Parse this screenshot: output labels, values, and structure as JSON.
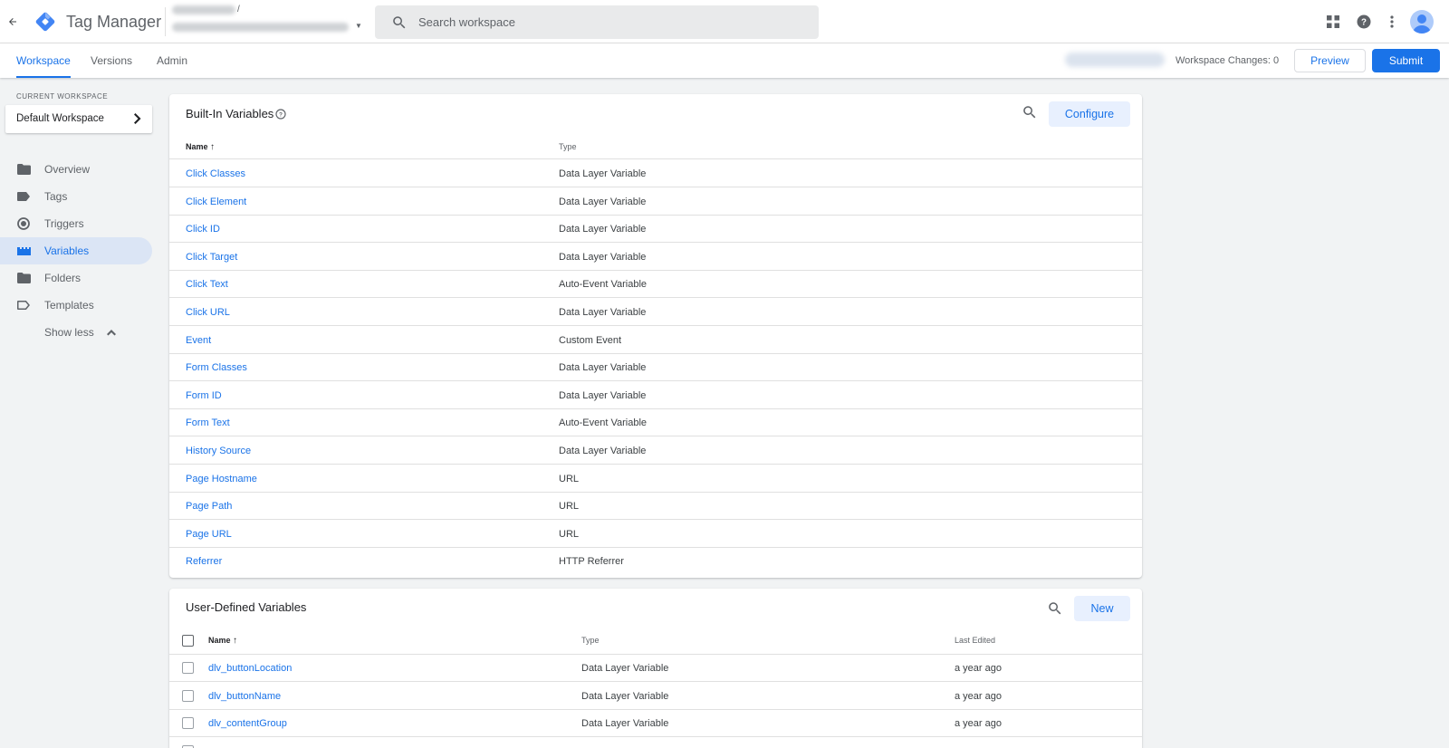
{
  "app": {
    "title": "Tag Manager",
    "account_separator": "/"
  },
  "search": {
    "placeholder": "Search workspace"
  },
  "top_icons": [
    "apps-grid-icon",
    "help-icon",
    "more-vert-icon",
    "account-avatar"
  ],
  "nav_tabs": [
    {
      "label": "Workspace",
      "active": true
    },
    {
      "label": "Versions",
      "active": false
    },
    {
      "label": "Admin",
      "active": false
    }
  ],
  "workspace_changes": "Workspace Changes: 0",
  "buttons": {
    "preview": "Preview",
    "submit": "Submit"
  },
  "sidebar": {
    "current_workspace_label": "CURRENT WORKSPACE",
    "current_workspace_name": "Default Workspace",
    "items": [
      {
        "label": "Overview",
        "icon": "folder-dark-icon",
        "active": false
      },
      {
        "label": "Tags",
        "icon": "label-icon",
        "active": false
      },
      {
        "label": "Triggers",
        "icon": "trigger-icon",
        "active": false
      },
      {
        "label": "Variables",
        "icon": "variables-icon",
        "active": true
      },
      {
        "label": "Folders",
        "icon": "folder-icon",
        "active": false
      },
      {
        "label": "Templates",
        "icon": "template-icon",
        "active": false
      }
    ],
    "show_less": "Show less"
  },
  "builtin": {
    "title": "Built-In Variables",
    "configure_label": "Configure",
    "columns": {
      "name": "Name",
      "type": "Type"
    },
    "rows": [
      {
        "name": "Click Classes",
        "type": "Data Layer Variable"
      },
      {
        "name": "Click Element",
        "type": "Data Layer Variable"
      },
      {
        "name": "Click ID",
        "type": "Data Layer Variable"
      },
      {
        "name": "Click Target",
        "type": "Data Layer Variable"
      },
      {
        "name": "Click Text",
        "type": "Auto-Event Variable"
      },
      {
        "name": "Click URL",
        "type": "Data Layer Variable"
      },
      {
        "name": "Event",
        "type": "Custom Event"
      },
      {
        "name": "Form Classes",
        "type": "Data Layer Variable"
      },
      {
        "name": "Form ID",
        "type": "Data Layer Variable"
      },
      {
        "name": "Form Text",
        "type": "Auto-Event Variable"
      },
      {
        "name": "History Source",
        "type": "Data Layer Variable"
      },
      {
        "name": "Page Hostname",
        "type": "URL"
      },
      {
        "name": "Page Path",
        "type": "URL"
      },
      {
        "name": "Page URL",
        "type": "URL"
      },
      {
        "name": "Referrer",
        "type": "HTTP Referrer"
      }
    ]
  },
  "userdefined": {
    "title": "User-Defined Variables",
    "new_label": "New",
    "columns": {
      "name": "Name",
      "type": "Type",
      "last_edited": "Last Edited"
    },
    "rows": [
      {
        "name": "dlv_buttonLocation",
        "type": "Data Layer Variable",
        "last_edited": "a year ago"
      },
      {
        "name": "dlv_buttonName",
        "type": "Data Layer Variable",
        "last_edited": "a year ago"
      },
      {
        "name": "dlv_contentGroup",
        "type": "Data Layer Variable",
        "last_edited": "a year ago"
      }
    ]
  },
  "colors": {
    "accent": "#1a73e8",
    "active_nav_bg": "#dbe5f5",
    "button_tint": "#e8f0fe",
    "page_bg": "#f1f3f4"
  }
}
